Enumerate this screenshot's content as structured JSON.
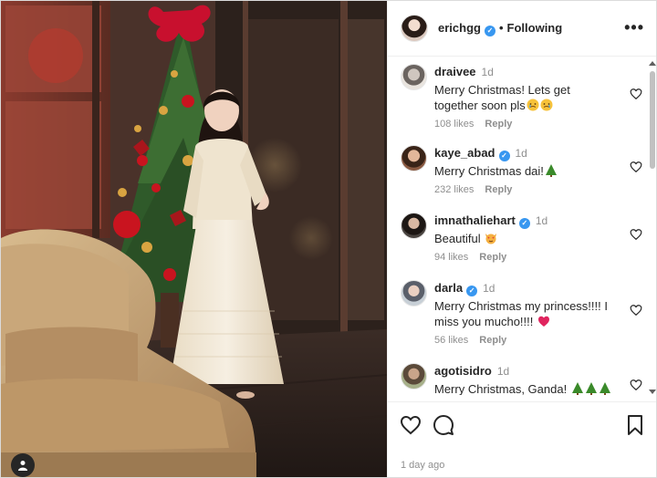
{
  "post": {
    "username": "erichgg",
    "verified_mark": "✓",
    "separator": "•",
    "follow_state": "Following",
    "more_label": "•••",
    "time_ago": "1 day ago"
  },
  "comments": [
    {
      "username": "draivee",
      "verified": false,
      "time": "1d",
      "text": "Merry Christmas! Lets get together soon pls",
      "emojis": [
        "crying-face",
        "crying-face"
      ],
      "likes": "108 likes",
      "reply": "Reply"
    },
    {
      "username": "kaye_abad",
      "verified": true,
      "time": "1d",
      "text": "Merry Christmas dai!",
      "emojis": [
        "christmas-tree"
      ],
      "likes": "232 likes",
      "reply": "Reply"
    },
    {
      "username": "imnathaliehart",
      "verified": true,
      "time": "1d",
      "text": "Beautiful",
      "emojis": [
        "cat-heart-eyes"
      ],
      "likes": "94 likes",
      "reply": "Reply"
    },
    {
      "username": "darla",
      "verified": true,
      "time": "1d",
      "text": "Merry Christmas my princess!!!! I miss you mucho!!!!",
      "emojis": [
        "red-heart"
      ],
      "likes": "56 likes",
      "reply": "Reply"
    },
    {
      "username": "agotisidro",
      "verified": false,
      "time": "1d",
      "text": "Merry Christmas, Ganda!",
      "emojis": [
        "christmas-tree",
        "christmas-tree",
        "christmas-tree"
      ],
      "likes": "",
      "reply": ""
    }
  ],
  "icons": [
    "heart-icon",
    "comment-icon",
    "bookmark-icon",
    "tag-person-icon",
    "more-icon"
  ],
  "colors": {
    "verified": "#3897f0",
    "muted": "#8e8e8e",
    "text": "#262626",
    "heart_red": "#ed4956",
    "tree_green": "#3a8a2a"
  }
}
